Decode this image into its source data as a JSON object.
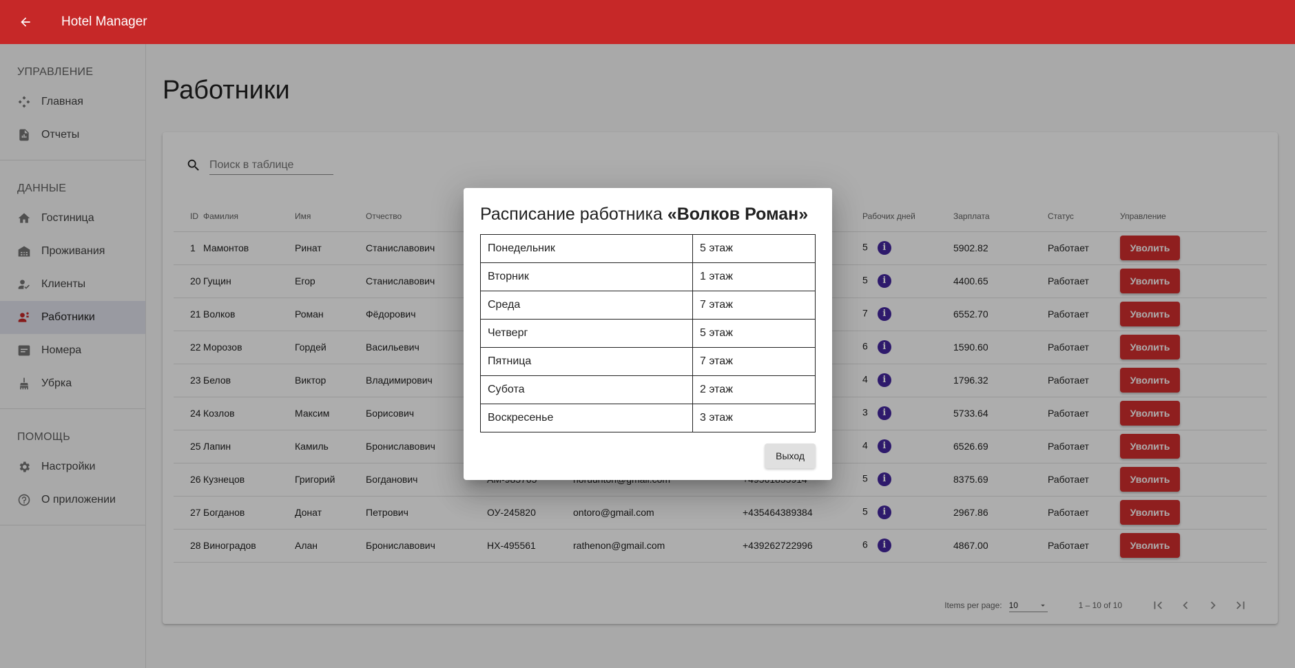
{
  "app": {
    "title": "Hotel Manager"
  },
  "sidebar": {
    "sections": [
      {
        "header": "УПРАВЛЕНИЕ",
        "items": [
          {
            "label": "Главная",
            "icon": "dashboard-icon"
          },
          {
            "label": "Отчеты",
            "icon": "reports-icon"
          }
        ]
      },
      {
        "header": "ДАННЫЕ",
        "items": [
          {
            "label": "Гостиница",
            "icon": "home-icon"
          },
          {
            "label": "Проживания",
            "icon": "hotel-icon"
          },
          {
            "label": "Клиенты",
            "icon": "clients-icon"
          },
          {
            "label": "Работники",
            "icon": "workers-icon",
            "active": true
          },
          {
            "label": "Номера",
            "icon": "rooms-icon"
          },
          {
            "label": "Убрка",
            "icon": "cleaning-icon"
          }
        ]
      },
      {
        "header": "ПОМОЩЬ",
        "items": [
          {
            "label": "Настройки",
            "icon": "gear-icon"
          },
          {
            "label": "О приложении",
            "icon": "help-icon"
          }
        ]
      }
    ]
  },
  "main": {
    "title": "Работники",
    "search": {
      "placeholder": "Поиск в таблице"
    },
    "table": {
      "columns": [
        "ID",
        "Фамилия",
        "Имя",
        "Отчество",
        "Рабочих дней",
        "Зарплата",
        "Статус",
        "Управление"
      ],
      "rows": [
        {
          "id": "1",
          "last": "Мамонтов",
          "first": "Ринат",
          "middle": "Станиславович",
          "passport": "",
          "email": "",
          "phone": "",
          "days": "5",
          "salary": "5902.82",
          "status": "Работает"
        },
        {
          "id": "20",
          "last": "Гущин",
          "first": "Егор",
          "middle": "Станиславович",
          "passport": "",
          "email": "",
          "phone": "",
          "days": "5",
          "salary": "4400.65",
          "status": "Работает"
        },
        {
          "id": "21",
          "last": "Волков",
          "first": "Роман",
          "middle": "Фёдорович",
          "passport": "",
          "email": "",
          "phone": "",
          "days": "7",
          "salary": "6552.70",
          "status": "Работает"
        },
        {
          "id": "22",
          "last": "Морозов",
          "first": "Гордей",
          "middle": "Васильевич",
          "passport": "",
          "email": "",
          "phone": "",
          "days": "6",
          "salary": "1590.60",
          "status": "Работает"
        },
        {
          "id": "23",
          "last": "Белов",
          "first": "Виктор",
          "middle": "Владимирович",
          "passport": "",
          "email": "",
          "phone": "",
          "days": "4",
          "salary": "1796.32",
          "status": "Работает"
        },
        {
          "id": "24",
          "last": "Козлов",
          "first": "Максим",
          "middle": "Борисович",
          "passport": "",
          "email": "",
          "phone": "",
          "days": "3",
          "salary": "5733.64",
          "status": "Работает"
        },
        {
          "id": "25",
          "last": "Лапин",
          "first": "Камиль",
          "middle": "Брониславович",
          "passport": "",
          "email": "",
          "phone": "",
          "days": "4",
          "salary": "6526.69",
          "status": "Работает"
        },
        {
          "id": "26",
          "last": "Кузнецов",
          "first": "Григорий",
          "middle": "Богданович",
          "passport": "АМ-985765",
          "email": "noruunton@gmail.com",
          "phone": "+49561855914",
          "days": "5",
          "salary": "8375.69",
          "status": "Работает"
        },
        {
          "id": "27",
          "last": "Богданов",
          "first": "Донат",
          "middle": "Петрович",
          "passport": "ОУ-245820",
          "email": "ontoro@gmail.com",
          "phone": "+435464389384",
          "days": "5",
          "salary": "2967.86",
          "status": "Работает"
        },
        {
          "id": "28",
          "last": "Виноградов",
          "first": "Алан",
          "middle": "Брониславович",
          "passport": "НХ-495561",
          "email": "rathenon@gmail.com",
          "phone": "+439262722996",
          "days": "6",
          "salary": "4867.00",
          "status": "Работает"
        }
      ],
      "fire_label": "Уволить",
      "info_glyph": "i"
    },
    "paginator": {
      "items_per_page_label": "Items per page:",
      "page_size": "10",
      "range": "1 – 10 of 10"
    }
  },
  "dialog": {
    "title_prefix": "Расписание работника ",
    "title_name": "«Волков Роман»",
    "schedule": [
      {
        "day": "Понедельник",
        "floor": "5 этаж"
      },
      {
        "day": "Вторник",
        "floor": "1 этаж"
      },
      {
        "day": "Среда",
        "floor": "7 этаж"
      },
      {
        "day": "Четверг",
        "floor": "5 этаж"
      },
      {
        "day": "Пятница",
        "floor": "7 этаж"
      },
      {
        "day": "Субота",
        "floor": "2 этаж"
      },
      {
        "day": "Воскресенье",
        "floor": "3 этаж"
      }
    ],
    "exit_label": "Выход"
  },
  "colors": {
    "primary": "#c62828",
    "fire_button": "#d32f2f",
    "info_icon": "#4527a0"
  }
}
